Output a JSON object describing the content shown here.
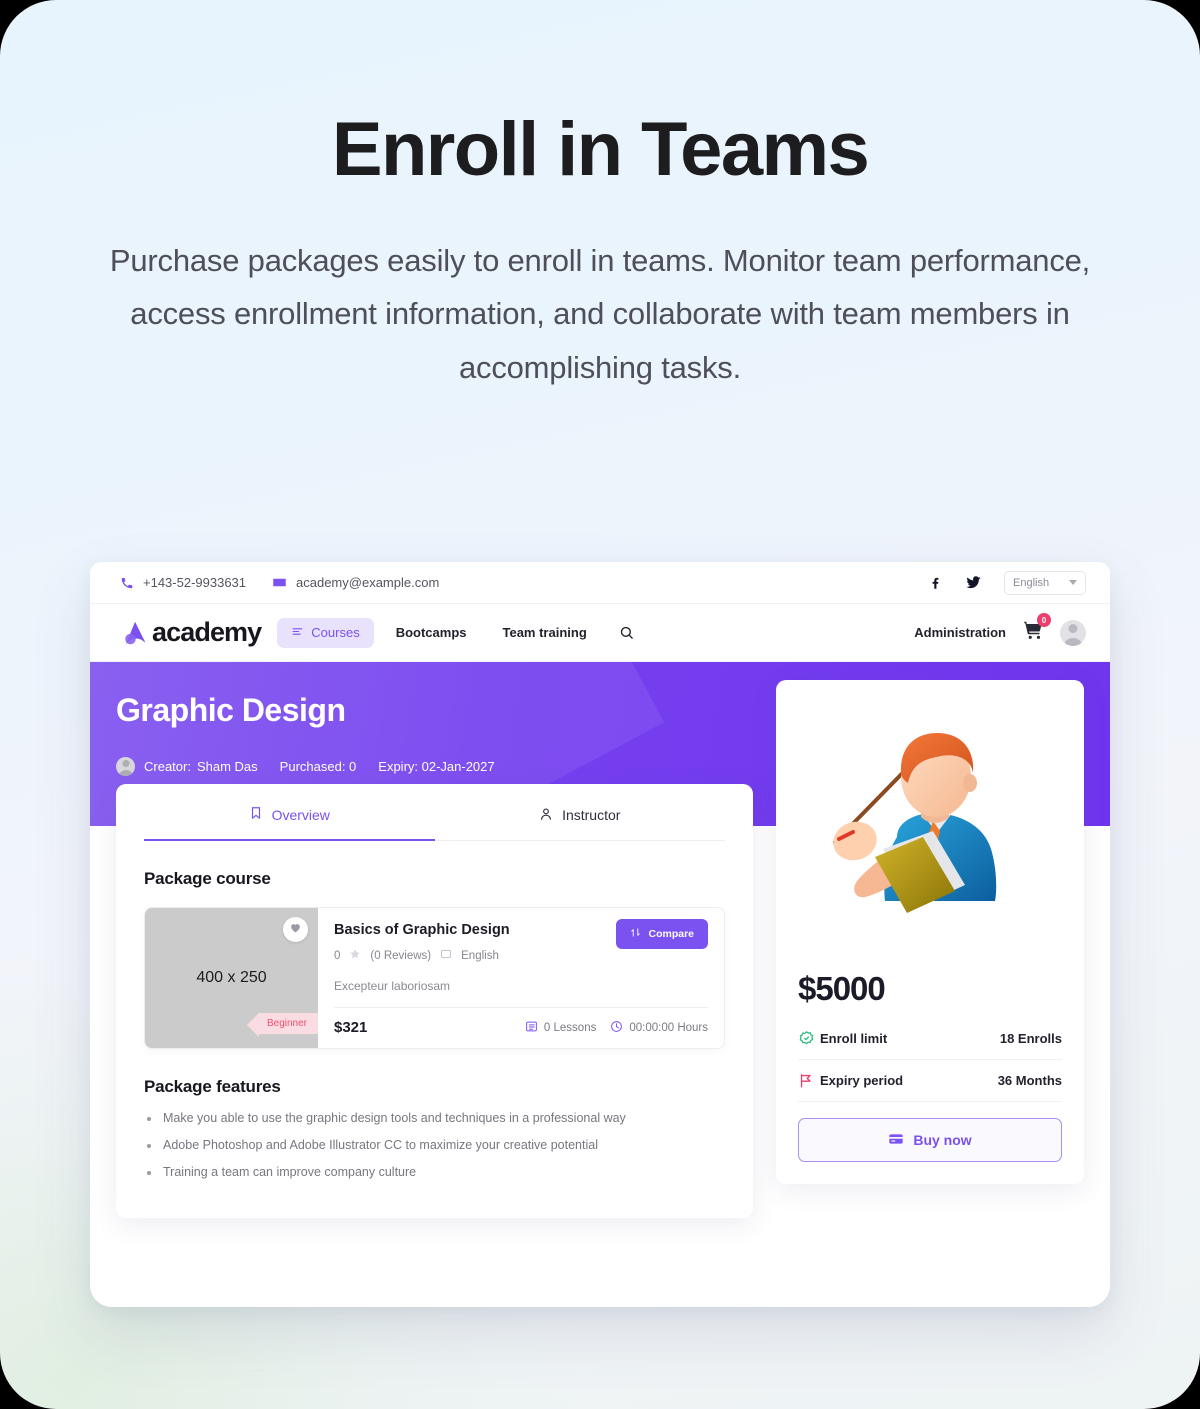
{
  "hero": {
    "title": "Enroll in Teams",
    "subtitle": "Purchase packages easily to enroll in teams. Monitor team performance, access enrollment information, and collaborate with team members in accomplishing tasks."
  },
  "topbar": {
    "phone": "+143-52-9933631",
    "email": "academy@example.com",
    "facebook_label": "f",
    "language": "English"
  },
  "nav": {
    "brand": "academy",
    "courses": "Courses",
    "bootcamps": "Bootcamps",
    "team_training": "Team training",
    "administration": "Administration",
    "cart_count": "0"
  },
  "band": {
    "title": "Graphic Design",
    "creator_label": "Creator:",
    "creator_name": "Sham Das",
    "purchased": "Purchased: 0",
    "expiry": "Expiry: 02-Jan-2027"
  },
  "tabs": {
    "overview": "Overview",
    "instructor": "Instructor"
  },
  "package_course": {
    "heading": "Package course",
    "thumb_text": "400 x 250",
    "level": "Beginner",
    "name": "Basics of Graphic Design",
    "rating": "0",
    "reviews": "(0 Reviews)",
    "language": "English",
    "description": "Excepteur laboriosam",
    "price": "$321",
    "lessons": "0 Lessons",
    "hours": "00:00:00 Hours",
    "compare": "Compare"
  },
  "package_features": {
    "heading": "Package features",
    "items": [
      "Make you able to use the graphic design tools and techniques in a professional way",
      "Adobe Photoshop and Adobe Illustrator CC to maximize your creative potential",
      "Training a team can improve company culture"
    ]
  },
  "sidebar": {
    "price": "$5000",
    "enroll_limit_label": "Enroll limit",
    "enroll_limit_value": "18 Enrolls",
    "expiry_period_label": "Expiry period",
    "expiry_period_value": "36 Months",
    "buy_now": "Buy now"
  },
  "colors": {
    "accent": "#7b51f0",
    "band_start": "#8054ef",
    "band_end": "#6f35ee",
    "badge": "#ee3e6d",
    "level_tag_text": "#ee4f72",
    "level_tag_bg": "#fadde3",
    "green": "#2bbd7e"
  }
}
